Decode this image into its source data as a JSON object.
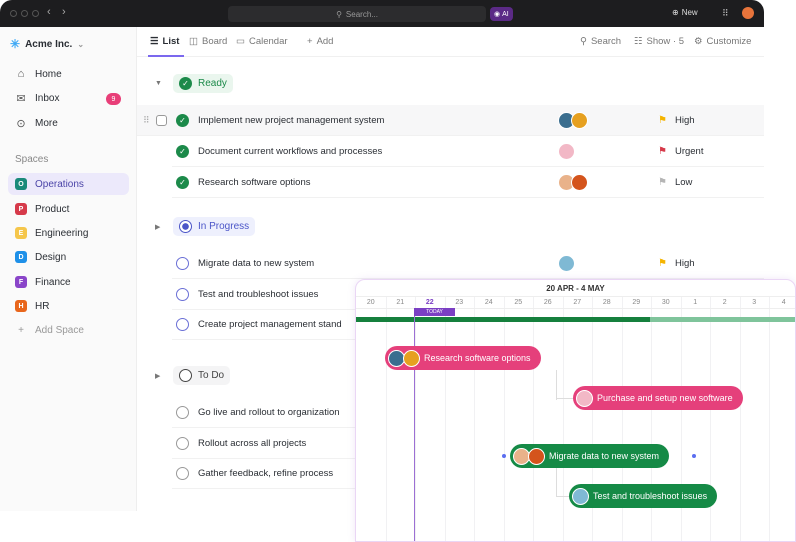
{
  "titlebar": {
    "search_placeholder": "Search...",
    "ai_label": "AI",
    "new_label": "New"
  },
  "workspace": {
    "name": "Acme Inc."
  },
  "nav": [
    {
      "label": "Home",
      "icon": "home-icon"
    },
    {
      "label": "Inbox",
      "icon": "inbox-icon",
      "badge": "9"
    },
    {
      "label": "More",
      "icon": "more-icon"
    }
  ],
  "spaces_label": "Spaces",
  "spaces": [
    {
      "letter": "O",
      "label": "Operations",
      "color": "#1a8a7a",
      "active": true
    },
    {
      "letter": "P",
      "label": "Product",
      "color": "#d63a4a"
    },
    {
      "letter": "E",
      "label": "Engineering",
      "color": "#f5c64b"
    },
    {
      "letter": "D",
      "label": "Design",
      "color": "#1e90e8"
    },
    {
      "letter": "F",
      "label": "Finance",
      "color": "#8a45c9"
    },
    {
      "letter": "H",
      "label": "HR",
      "color": "#e8661c"
    }
  ],
  "add_space": "Add Space",
  "views": {
    "list": "List",
    "board": "Board",
    "calendar": "Calendar",
    "add": "Add"
  },
  "tools": {
    "search": "Search",
    "show": "Show · 5",
    "customize": "Customize"
  },
  "groups": [
    {
      "label": "Ready",
      "tasks": [
        {
          "name": "Implement new project management system",
          "priority": "High",
          "flag_color": "#f5b400"
        },
        {
          "name": "Document current workflows and processes",
          "priority": "Urgent",
          "flag_color": "#d63a4a"
        },
        {
          "name": "Research software options",
          "priority": "Low",
          "flag_color": "#b5b5b5"
        }
      ]
    },
    {
      "label": "In Progress",
      "tasks": [
        {
          "name": "Migrate data to new system",
          "priority": "High",
          "flag_color": "#f5b400"
        },
        {
          "name": "Test and troubleshoot issues"
        },
        {
          "name": "Create project management stand"
        }
      ]
    },
    {
      "label": "To Do",
      "tasks": [
        {
          "name": "Go live and rollout to organization"
        },
        {
          "name": "Rollout across all projects"
        },
        {
          "name": "Gather feedback, refine process"
        }
      ]
    }
  ],
  "gantt": {
    "range": "20 APR - 4 MAY",
    "days": [
      "20",
      "21",
      "22",
      "23",
      "24",
      "25",
      "26",
      "27",
      "28",
      "29",
      "30",
      "1",
      "2",
      "3",
      "4"
    ],
    "today_label": "TODAY",
    "today_index": 2,
    "progress": 0.67,
    "bars": [
      {
        "label": "Research software options",
        "color": "pink"
      },
      {
        "label": "Purchase and setup new software",
        "color": "pink"
      },
      {
        "label": "Migrate data to new system",
        "color": "green"
      },
      {
        "label": "Test and troubleshoot issues",
        "color": "green"
      }
    ]
  }
}
